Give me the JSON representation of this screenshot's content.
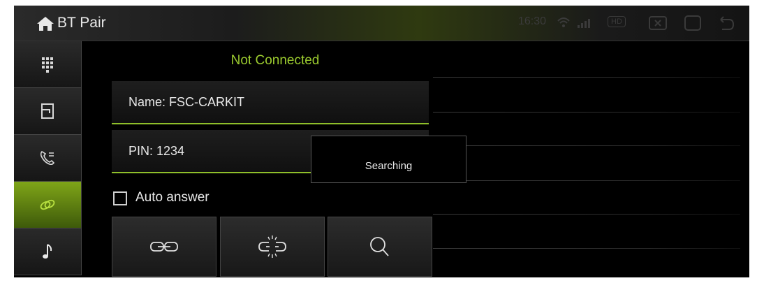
{
  "app": {
    "title": "BT Pair",
    "home_icon": "home-icon"
  },
  "status_bar": {
    "time": "16:30",
    "hd_label": "HD",
    "icons": [
      "wifi-icon",
      "signal-icon",
      "hd-badge",
      "screenshot-icon",
      "window-icon",
      "back-icon"
    ]
  },
  "sidebar": {
    "items": [
      {
        "name": "keypad",
        "icon": "keypad-icon",
        "active": false
      },
      {
        "name": "contacts",
        "icon": "contacts-icon",
        "active": false
      },
      {
        "name": "call-log",
        "icon": "call-log-icon",
        "active": false
      },
      {
        "name": "pairing",
        "icon": "link-icon",
        "active": true
      },
      {
        "name": "music",
        "icon": "music-note-icon",
        "active": false
      }
    ],
    "active_color": "#7fa518"
  },
  "main": {
    "connection_status": "Not Connected",
    "name_label": "Name:  FSC-CARKIT",
    "pin_label": "PIN:  1234",
    "auto_answer_label": "Auto answer",
    "auto_answer_checked": false,
    "buttons": [
      {
        "name": "connect",
        "icon": "link-icon"
      },
      {
        "name": "disconnect",
        "icon": "unlink-icon"
      },
      {
        "name": "search",
        "icon": "search-icon"
      }
    ]
  },
  "popup": {
    "text": "Searching"
  },
  "colors": {
    "accent": "#9ccc2f",
    "field_underline": "#8fbf2a",
    "background": "#000000"
  }
}
